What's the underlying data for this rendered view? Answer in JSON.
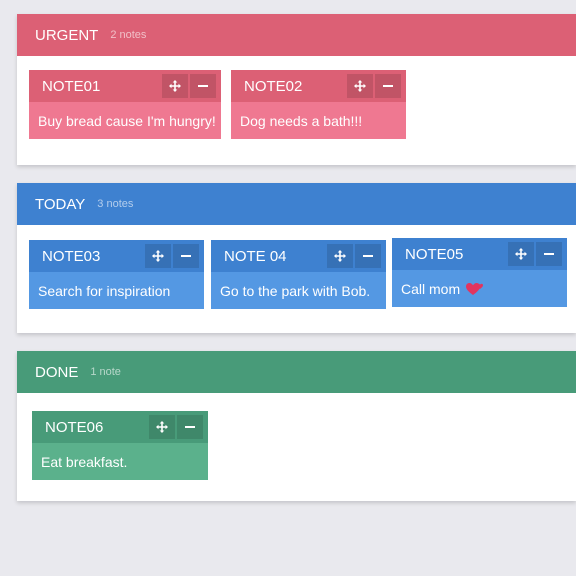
{
  "colors": {
    "urgent_header": "#dc6075",
    "urgent_note_head": "#dc6075",
    "urgent_note_body": "#ef7891",
    "today_header": "#3e81d0",
    "today_note_head": "#3e81d0",
    "today_note_body": "#5498e3",
    "done_header": "#489b79",
    "done_note_head": "#489b79",
    "done_note_body": "#5bb18c",
    "heart": "#e2345f"
  },
  "boards": [
    {
      "title": "URGENT",
      "count": "2 notes",
      "notes": [
        {
          "title": "NOTE01",
          "text": "Buy bread cause I'm hungry!",
          "move_icon": "move-icon",
          "remove_icon": "minus-icon"
        },
        {
          "title": "NOTE02",
          "text": "Dog needs a bath!!!",
          "move_icon": "move-icon",
          "remove_icon": "minus-icon"
        }
      ]
    },
    {
      "title": "TODAY",
      "count": "3 notes",
      "notes": [
        {
          "title": "NOTE03",
          "text": "Search for inspiration",
          "move_icon": "move-icon",
          "remove_icon": "minus-icon"
        },
        {
          "title": "NOTE 04",
          "text": "Go to the park with Bob.",
          "move_icon": "move-icon",
          "remove_icon": "minus-icon"
        },
        {
          "title": "NOTE05",
          "text": "Call mom",
          "emoji": "two-hearts-icon",
          "move_icon": "move-icon",
          "remove_icon": "minus-icon"
        }
      ]
    },
    {
      "title": "DONE",
      "count": "1 note",
      "notes": [
        {
          "title": "NOTE06",
          "text": "Eat breakfast.",
          "move_icon": "move-icon",
          "remove_icon": "minus-icon"
        }
      ]
    }
  ]
}
